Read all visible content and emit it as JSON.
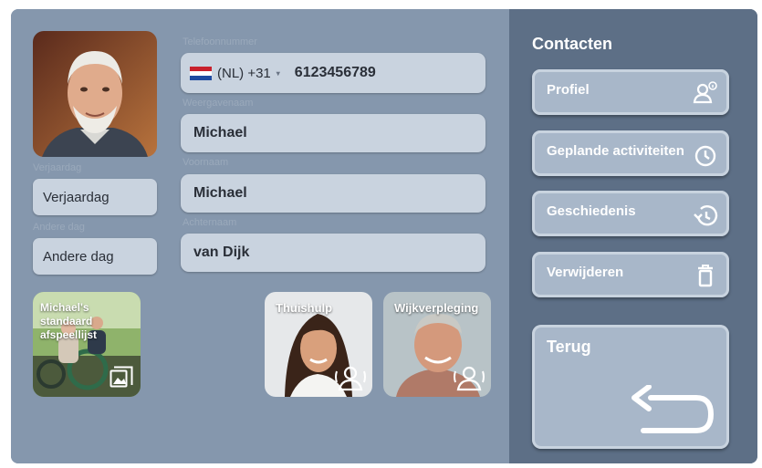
{
  "profile": {
    "labels": {
      "phone": "Telefoonnummer",
      "display_name": "Weergavenaam",
      "first_name": "Voornaam",
      "last_name": "Achternaam",
      "birthday": "Verjaardag",
      "other_day": "Andere dag"
    },
    "phone": {
      "country": "(NL) +31",
      "number": "6123456789"
    },
    "display_name": "Michael",
    "first_name": "Michael",
    "last_name": "van Dijk",
    "birthday": "Verjaardag",
    "anniversary": "Andere dag"
  },
  "playlist": {
    "label": "Michael's standaard afspeellijst"
  },
  "caregivers": [
    {
      "label": "Thuishulp"
    },
    {
      "label": "Wijkverpleging"
    }
  ],
  "sidebar": {
    "title": "Contacten",
    "items": [
      {
        "label": "Profiel",
        "icon": "person-info-icon"
      },
      {
        "label": "Geplande activiteiten",
        "icon": "clock-icon"
      },
      {
        "label": "Geschiedenis",
        "icon": "history-icon"
      },
      {
        "label": "Verwijderen",
        "icon": "trash-icon"
      }
    ],
    "back_label": "Terug"
  },
  "colors": {
    "panel": "#8597ad",
    "sidebar": "#5d6f86",
    "field": "#c9d3df",
    "button": "#a8b7c9"
  }
}
